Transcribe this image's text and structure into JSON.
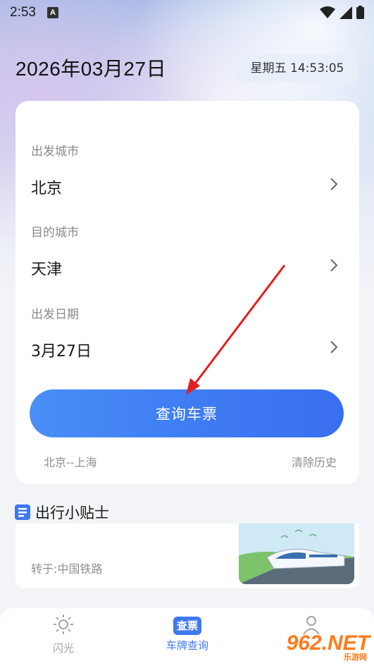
{
  "status_bar": {
    "time": "2:53",
    "notification_letter": "A"
  },
  "header": {
    "date": "2026年03月27日",
    "weekday_time": "星期五 14:53:05"
  },
  "form": {
    "departure_label": "出发城市",
    "departure_value": "北京",
    "destination_label": "目的城市",
    "destination_value": "天津",
    "date_label": "出发日期",
    "date_value": "3月27日",
    "search_button": "查询车票",
    "history_item": "北京--上海",
    "clear_history": "清除历史"
  },
  "tips": {
    "title": "出行小贴士",
    "source": "转于:中国铁路"
  },
  "tabbar": {
    "tabs": [
      {
        "label": "闪光",
        "icon": "sun-icon",
        "active": false
      },
      {
        "label": "车牌查询",
        "icon_text": "查票",
        "active": true
      },
      {
        "label": "",
        "icon": "person-icon",
        "active": false
      }
    ]
  },
  "watermark": {
    "text": "962.NET",
    "sub": "乐游网"
  },
  "colors": {
    "accent": "#3f79ee",
    "annotation_arrow": "#e0201f"
  }
}
